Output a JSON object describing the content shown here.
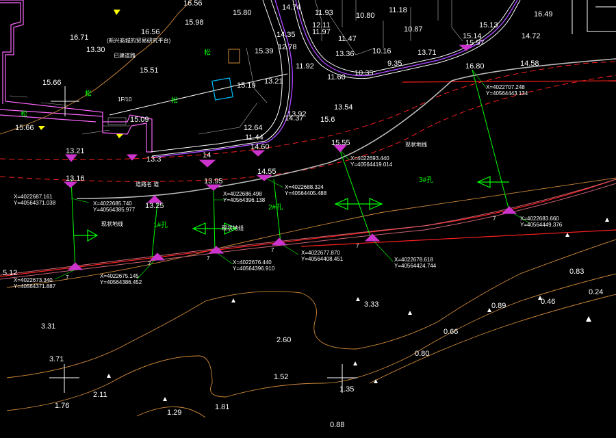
{
  "drawing": {
    "background": "#000000",
    "colors": {
      "building": "#ff66ff",
      "road": "#ffffff",
      "contour": "#d28b3a",
      "redline": "#ff2020",
      "dash": "#ff2020",
      "green": "#00ff00",
      "pier": "#cc33cc",
      "text": "#ffffff",
      "cyan": "#00bfff",
      "yellow": "#ffff00",
      "gray": "#bbbbbb"
    },
    "elevations": [
      "16.56",
      "15.80",
      "15.98",
      "16.71",
      "13.30",
      "16.56",
      "15.51",
      "15.66",
      "15.19",
      "13.21",
      "15.39",
      "14.74",
      "11.93",
      "12.11",
      "11.97",
      "14.35",
      "12.78",
      "11.47",
      "13.36",
      "10.80",
      "11.18",
      "10.87",
      "10.16",
      "9.35",
      "13.71",
      "11.92",
      "10.35",
      "11.60",
      "13.54",
      "16.49",
      "15.14",
      "15.13",
      "15.57",
      "14.72",
      "14.58",
      "16.80",
      "13.92",
      "14.37",
      "15.6",
      "12.64",
      "11.44",
      "14.60",
      "15.55",
      "15.66",
      "15.09",
      "13.21",
      "13.3",
      "14",
      "13.16",
      "13.95",
      "13.25",
      "14.55",
      "5.12",
      "3.31",
      "3.71",
      "1.76",
      "2.11",
      "1.29",
      "1.81",
      "2.60",
      "3.33",
      "1.52",
      "1.35",
      "0.88",
      "0.80",
      "0.66",
      "0.89",
      "0.46",
      "0.24",
      "0.83"
    ],
    "coordinates": [
      {
        "x": "X=4022687.161",
        "y": "Y=40564371.038"
      },
      {
        "x": "X=4022685.740",
        "y": "Y=40564385.977"
      },
      {
        "x": "X=4022686.498",
        "y": "Y=40564396.138"
      },
      {
        "x": "X=4022688.324",
        "y": "Y=40564405.488"
      },
      {
        "x": "X=4022693.440",
        "y": "Y=40564419.014"
      },
      {
        "x": "X=4022707.248",
        "y": "Y=40564443.134"
      },
      {
        "x": "X=4022683.660",
        "y": "Y=40564449.376"
      },
      {
        "x": "X=4022673.340",
        "y": "Y=40564371.887"
      },
      {
        "x": "X=4022675.145",
        "y": "Y=40564386.452"
      },
      {
        "x": "X=4022676.440",
        "y": "Y=40564396.910"
      },
      {
        "x": "X=4022677.870",
        "y": "Y=40564408.451"
      },
      {
        "x": "X=4022678.618",
        "y": "Y=40564424.744"
      }
    ],
    "span_labels": [
      "1#孔",
      "2#孔",
      "3#孔"
    ],
    "pier_numbers": [
      "7",
      "7",
      "7",
      "7",
      "7",
      "7",
      "7"
    ],
    "small_labels": [
      "(新兴商城的贸易研究平台)",
      "已建道路",
      "1F/10",
      "松",
      "松",
      "松",
      "松",
      "道路名 道",
      "现状地线",
      "现状地线",
      "现状地线"
    ],
    "road_labels": [
      "1F",
      "1F"
    ]
  }
}
